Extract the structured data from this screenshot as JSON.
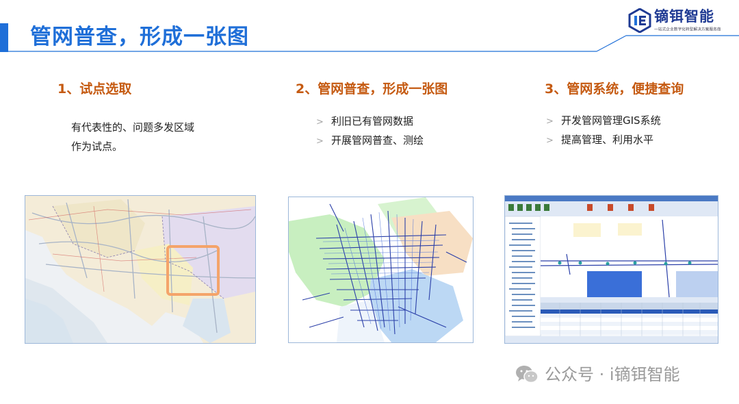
{
  "header": {
    "title": "管网普查，形成一张图",
    "logo": {
      "name": "镝铒智能",
      "tagline": "一站式企业数字化转型解决方案服务商",
      "icon": "de-logo-icon"
    }
  },
  "columns": [
    {
      "heading": "1、试点选取",
      "lines": [
        "有代表性的、问题多发区域",
        "作为试点。"
      ]
    },
    {
      "heading": "2、管网普查，形成一张图",
      "bullets": [
        "利旧已有管网数据",
        "开展管网普查、测绘"
      ]
    },
    {
      "heading": "3、管网系统，便捷查询",
      "bullets": [
        "开发管网管理GIS系统",
        "提高管理、利用水平"
      ]
    }
  ],
  "watermark": {
    "text": "公众号 · i镝铒智能",
    "icon": "wechat-icon"
  },
  "colors": {
    "accent": "#1f6fd8",
    "heading": "#c55a11",
    "highlight_box": "#f4a46a"
  }
}
